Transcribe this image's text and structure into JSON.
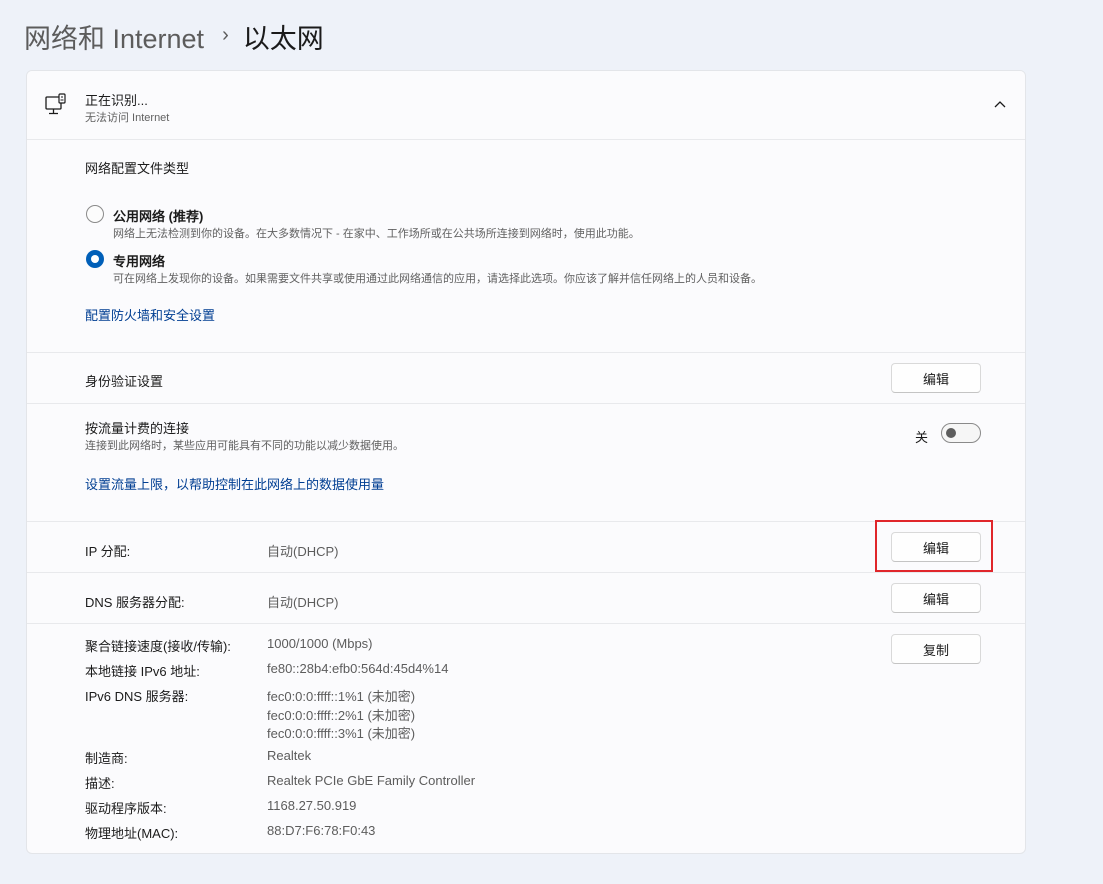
{
  "breadcrumb": {
    "parent": "网络和 Internet",
    "separator": "›",
    "current": "以太网"
  },
  "header": {
    "title": "正在识别...",
    "subtitle": "无法访问 Internet",
    "icon": "ethernet-monitor-icon"
  },
  "profile": {
    "heading": "网络配置文件类型",
    "options": [
      {
        "label": "公用网络 (推荐)",
        "description": "网络上无法检测到你的设备。在大多数情况下 - 在家中、工作场所或在公共场所连接到网络时，使用此功能。",
        "selected": false
      },
      {
        "label": "专用网络",
        "description": "可在网络上发现你的设备。如果需要文件共享或使用通过此网络通信的应用，请选择此选项。你应该了解并信任网络上的人员和设备。",
        "selected": true
      }
    ],
    "firewall_link": "配置防火墙和安全设置"
  },
  "auth": {
    "label": "身份验证设置",
    "button": "编辑"
  },
  "metered": {
    "title": "按流量计费的连接",
    "description": "连接到此网络时，某些应用可能具有不同的功能以减少数据使用。",
    "toggle_state": "关",
    "link": "设置流量上限，以帮助控制在此网络上的数据使用量"
  },
  "ip": {
    "label": "IP 分配:",
    "value": "自动(DHCP)",
    "button": "编辑"
  },
  "dns": {
    "label": "DNS 服务器分配:",
    "value": "自动(DHCP)",
    "button": "编辑"
  },
  "properties": {
    "copy_button": "复制",
    "link_speed": {
      "label": "聚合链接速度(接收/传输):",
      "value": "1000/1000 (Mbps)"
    },
    "ipv6_local": {
      "label": "本地链接 IPv6 地址:",
      "value": "fe80::28b4:efb0:564d:45d4%14"
    },
    "ipv6_dns": {
      "label": "IPv6 DNS 服务器:",
      "values": [
        "fec0:0:0:ffff::1%1 (未加密)",
        "fec0:0:0:ffff::2%1 (未加密)",
        "fec0:0:0:ffff::3%1 (未加密)"
      ]
    },
    "manufacturer": {
      "label": "制造商:",
      "value": "Realtek"
    },
    "description": {
      "label": "描述:",
      "value": "Realtek PCIe GbE Family Controller"
    },
    "driver_version": {
      "label": "驱动程序版本:",
      "value": "1168.27.50.919"
    },
    "mac": {
      "label": "物理地址(MAC):",
      "value": "88:D7:F6:78:F0:43"
    }
  },
  "colors": {
    "accent": "#005fb8",
    "link": "#003e92",
    "highlight_box": "#e0262b",
    "background": "#eef2f9",
    "card": "#fbfbfd"
  }
}
